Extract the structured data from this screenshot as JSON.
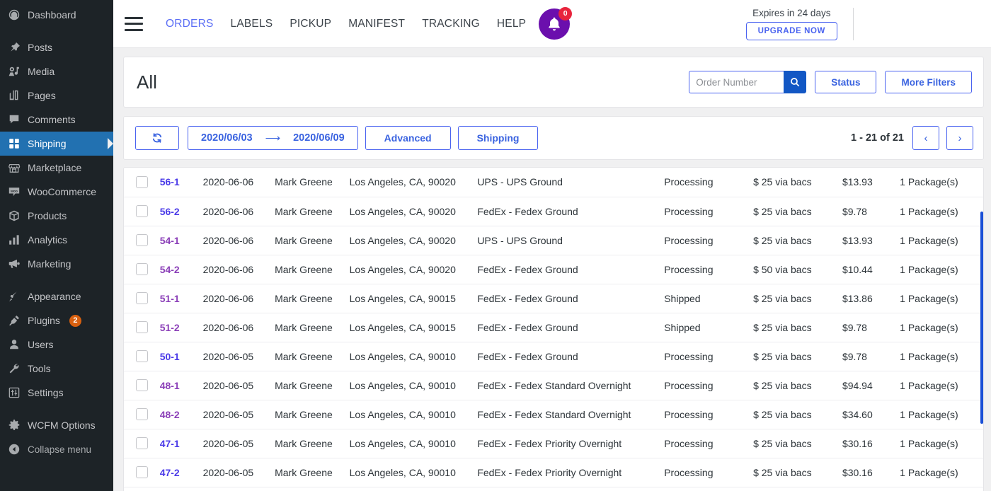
{
  "sidebar": {
    "items": [
      {
        "label": "Dashboard",
        "icon": "dashboard-icon",
        "active": false,
        "gap_after": true
      },
      {
        "label": "Posts",
        "icon": "pin-icon",
        "active": false
      },
      {
        "label": "Media",
        "icon": "media-icon",
        "active": false
      },
      {
        "label": "Pages",
        "icon": "pages-icon",
        "active": false
      },
      {
        "label": "Comments",
        "icon": "comment-icon",
        "active": false
      },
      {
        "label": "Shipping",
        "icon": "grid-icon",
        "active": true
      },
      {
        "label": "Marketplace",
        "icon": "store-icon",
        "active": false
      },
      {
        "label": "WooCommerce",
        "icon": "woo-icon",
        "active": false
      },
      {
        "label": "Products",
        "icon": "box-icon",
        "active": false
      },
      {
        "label": "Analytics",
        "icon": "bar-chart-icon",
        "active": false
      },
      {
        "label": "Marketing",
        "icon": "megaphone-icon",
        "active": false,
        "gap_after": true
      },
      {
        "label": "Appearance",
        "icon": "brush-icon",
        "active": false
      },
      {
        "label": "Plugins",
        "icon": "plug-icon",
        "active": false,
        "badge": "2"
      },
      {
        "label": "Users",
        "icon": "user-icon",
        "active": false
      },
      {
        "label": "Tools",
        "icon": "wrench-icon",
        "active": false
      },
      {
        "label": "Settings",
        "icon": "sliders-icon",
        "active": false,
        "gap_after": true
      },
      {
        "label": "WCFM Options",
        "icon": "gear-icon",
        "active": false
      }
    ],
    "collapse_label": "Collapse menu"
  },
  "topbar": {
    "nav": [
      {
        "label": "ORDERS",
        "active": true
      },
      {
        "label": "LABELS",
        "active": false
      },
      {
        "label": "PICKUP",
        "active": false
      },
      {
        "label": "MANIFEST",
        "active": false
      },
      {
        "label": "TRACKING",
        "active": false
      },
      {
        "label": "HELP",
        "active": false
      }
    ],
    "notification_count": "0",
    "expiry_text": "Expires in 24 days",
    "upgrade_label": "UPGRADE NOW"
  },
  "filterbar": {
    "title": "All",
    "search_placeholder": "Order Number",
    "search_value": "",
    "status_label": "Status",
    "more_filters_label": "More Filters"
  },
  "toolbar": {
    "date_from": "2020/06/03",
    "date_to": "2020/06/09",
    "date_arrow": "⟶",
    "advanced_label": "Advanced",
    "shipping_label": "Shipping",
    "pager_label": "1 - 21 of 21",
    "prev_label": "‹",
    "next_label": "›"
  },
  "colors": {
    "accent_blue": "#4a63f0",
    "link_blue": "#4a3ae8",
    "link_purple": "#8b3fb8",
    "sidebar_bg": "#1d2327",
    "sidebar_active": "#2271b1",
    "bell_purple": "#6b0fad",
    "badge_red": "#e8243c",
    "scrollbar_blue": "#1a4fd6"
  },
  "table": {
    "rows": [
      {
        "number": "56-1",
        "link_color": "blue",
        "date": "2020-06-06",
        "customer": "Mark Greene",
        "address": "Los Angeles, CA, 90020",
        "shipping": "UPS - UPS Ground",
        "status": "Processing",
        "payment": "$ 25 via bacs",
        "cost": "$13.93",
        "packages": "1 Package(s)"
      },
      {
        "number": "56-2",
        "link_color": "blue",
        "date": "2020-06-06",
        "customer": "Mark Greene",
        "address": "Los Angeles, CA, 90020",
        "shipping": "FedEx - Fedex Ground",
        "status": "Processing",
        "payment": "$ 25 via bacs",
        "cost": "$9.78",
        "packages": "1 Package(s)"
      },
      {
        "number": "54-1",
        "link_color": "purple",
        "date": "2020-06-06",
        "customer": "Mark Greene",
        "address": "Los Angeles, CA, 90020",
        "shipping": "UPS - UPS Ground",
        "status": "Processing",
        "payment": "$ 25 via bacs",
        "cost": "$13.93",
        "packages": "1 Package(s)"
      },
      {
        "number": "54-2",
        "link_color": "purple",
        "date": "2020-06-06",
        "customer": "Mark Greene",
        "address": "Los Angeles, CA, 90020",
        "shipping": "FedEx - Fedex Ground",
        "status": "Processing",
        "payment": "$ 50 via bacs",
        "cost": "$10.44",
        "packages": "1 Package(s)"
      },
      {
        "number": "51-1",
        "link_color": "purple",
        "date": "2020-06-06",
        "customer": "Mark Greene",
        "address": "Los Angeles, CA, 90015",
        "shipping": "FedEx - Fedex Ground",
        "status": "Shipped",
        "payment": "$ 25 via bacs",
        "cost": "$13.86",
        "packages": "1 Package(s)"
      },
      {
        "number": "51-2",
        "link_color": "purple",
        "date": "2020-06-06",
        "customer": "Mark Greene",
        "address": "Los Angeles, CA, 90015",
        "shipping": "FedEx - Fedex Ground",
        "status": "Shipped",
        "payment": "$ 25 via bacs",
        "cost": "$9.78",
        "packages": "1 Package(s)"
      },
      {
        "number": "50-1",
        "link_color": "blue",
        "date": "2020-06-05",
        "customer": "Mark Greene",
        "address": "Los Angeles, CA, 90010",
        "shipping": "FedEx - Fedex Ground",
        "status": "Processing",
        "payment": "$ 25 via bacs",
        "cost": "$9.78",
        "packages": "1 Package(s)"
      },
      {
        "number": "48-1",
        "link_color": "purple",
        "date": "2020-06-05",
        "customer": "Mark Greene",
        "address": "Los Angeles, CA, 90010",
        "shipping": "FedEx - Fedex Standard Overnight",
        "status": "Processing",
        "payment": "$ 25 via bacs",
        "cost": "$94.94",
        "packages": "1 Package(s)"
      },
      {
        "number": "48-2",
        "link_color": "purple",
        "date": "2020-06-05",
        "customer": "Mark Greene",
        "address": "Los Angeles, CA, 90010",
        "shipping": "FedEx - Fedex Standard Overnight",
        "status": "Processing",
        "payment": "$ 25 via bacs",
        "cost": "$34.60",
        "packages": "1 Package(s)"
      },
      {
        "number": "47-1",
        "link_color": "blue",
        "date": "2020-06-05",
        "customer": "Mark Greene",
        "address": "Los Angeles, CA, 90010",
        "shipping": "FedEx - Fedex Priority Overnight",
        "status": "Processing",
        "payment": "$ 25 via bacs",
        "cost": "$30.16",
        "packages": "1 Package(s)"
      },
      {
        "number": "47-2",
        "link_color": "blue",
        "date": "2020-06-05",
        "customer": "Mark Greene",
        "address": "Los Angeles, CA, 90010",
        "shipping": "FedEx - Fedex Priority Overnight",
        "status": "Processing",
        "payment": "$ 25 via bacs",
        "cost": "$30.16",
        "packages": "1 Package(s)"
      }
    ]
  }
}
